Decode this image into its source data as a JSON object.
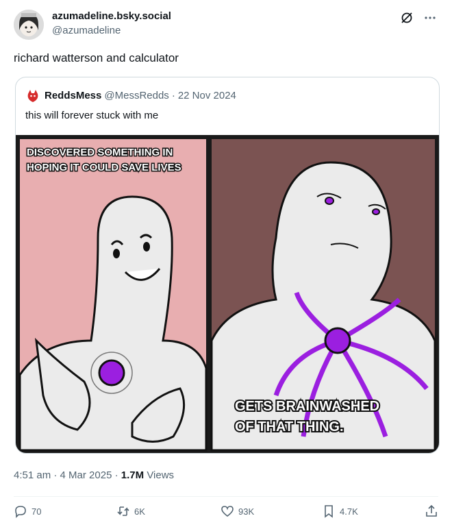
{
  "author": {
    "display_name": "azumadeline.bsky.social",
    "handle": "@azumadeline"
  },
  "post": {
    "text": "richard watterson and calculator",
    "time": "4:51 am",
    "date": "4 Mar 2025",
    "views_count": "1.7M",
    "views_label": "Views"
  },
  "quote": {
    "display_name": "ReddsMess",
    "handle": "@MessRedds",
    "separator": "·",
    "date": "22 Nov 2024",
    "text": "this will forever stuck with me",
    "comic": {
      "left_caption_line1": "DISCOVERED SOMETHING IN",
      "left_caption_line2": "HOPING IT COULD SAVE LIVES",
      "right_caption_line1": "GETS BRAINWASHED",
      "right_caption_line2": "OF THAT THING."
    }
  },
  "actions": {
    "reply_count": "70",
    "repost_count": "6K",
    "like_count": "93K",
    "bookmark_count": "4.7K"
  },
  "meta_separator": "·",
  "icons": {
    "header_left": "slash-circle-icon",
    "header_right": "more-icon",
    "reply": "reply-icon",
    "repost": "repost-icon",
    "like": "heart-icon",
    "bookmark": "bookmark-icon",
    "share": "share-icon"
  },
  "colors": {
    "text_primary": "#0f1419",
    "text_secondary": "#536471",
    "border": "#cfd9de",
    "panel_left_bg": "#e8aeb0",
    "panel_right_bg": "#7b5352",
    "orb_purple": "#9b1fe0"
  }
}
